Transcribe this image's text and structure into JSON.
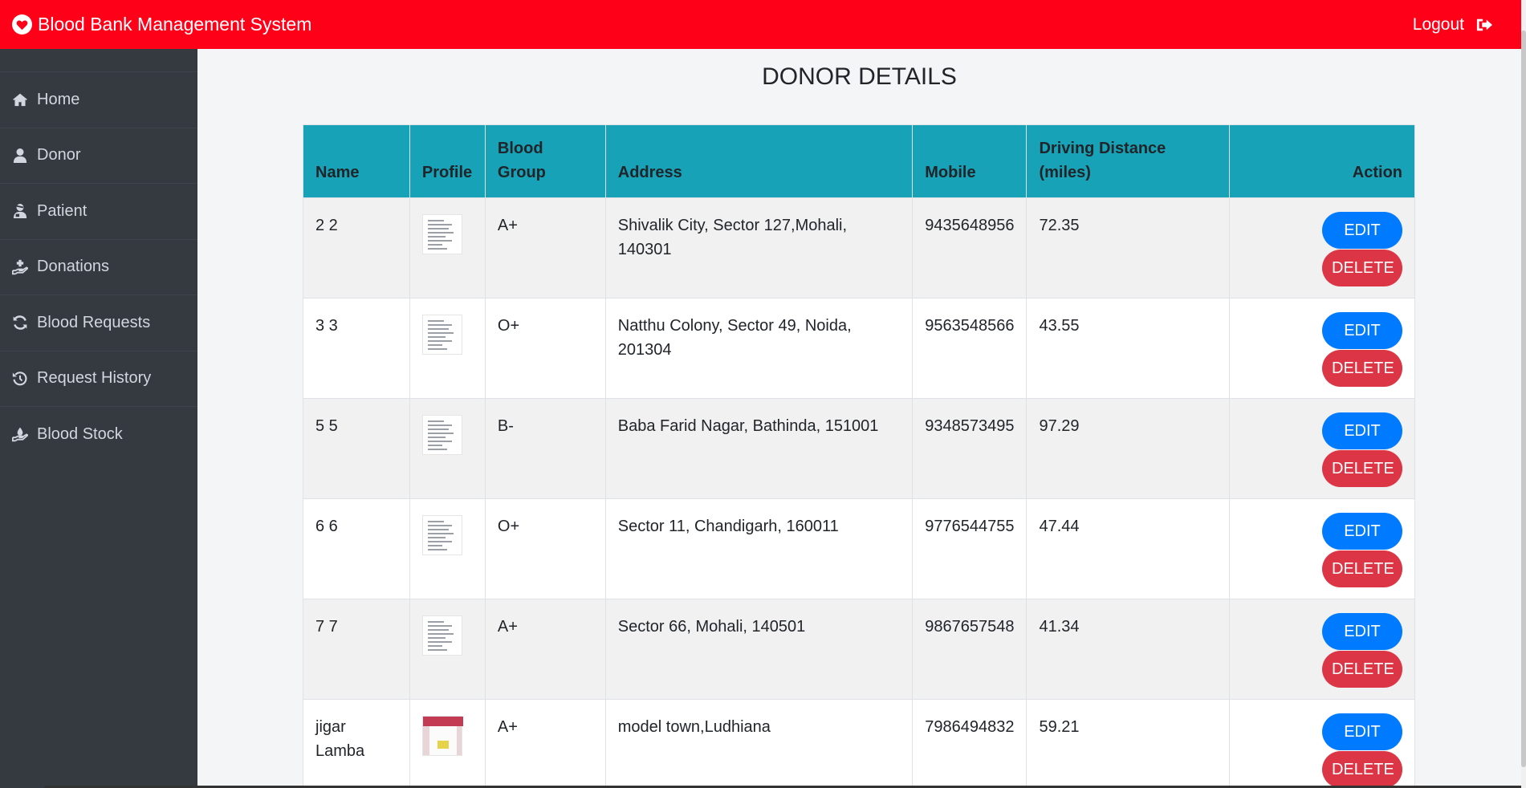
{
  "header": {
    "app_title": "Blood Bank Management System",
    "logout_label": "Logout",
    "brand_icon": "heart-icon",
    "logout_icon": "sign-out-icon",
    "brand_color": "#ff0019"
  },
  "sidebar": {
    "items": [
      {
        "label": "Home",
        "icon": "home-icon"
      },
      {
        "label": "Donor",
        "icon": "user-icon"
      },
      {
        "label": "Patient",
        "icon": "user-injured-icon"
      },
      {
        "label": "Donations",
        "icon": "hand-holding-plus-icon"
      },
      {
        "label": "Blood Requests",
        "icon": "sync-icon"
      },
      {
        "label": "Request History",
        "icon": "history-icon"
      },
      {
        "label": "Blood Stock",
        "icon": "hand-holding-icon"
      }
    ]
  },
  "main": {
    "page_title": "DONOR DETAILS",
    "columns": [
      "Name",
      "Profile",
      "Blood Group",
      "Address",
      "Mobile",
      "Driving Distance (miles)",
      "Action"
    ],
    "edit_label": "EDIT",
    "delete_label": "DELETE",
    "rows": [
      {
        "name": "2 2",
        "blood_group": "A+",
        "address": "Shivalik City, Sector 127,Mohali, 140301",
        "mobile": "9435648956",
        "distance": "72.35"
      },
      {
        "name": "3 3",
        "blood_group": "O+",
        "address": "Natthu Colony, Sector 49, Noida, 201304",
        "mobile": "9563548566",
        "distance": "43.55"
      },
      {
        "name": "5 5",
        "blood_group": "B-",
        "address": "Baba Farid Nagar, Bathinda, 151001",
        "mobile": "9348573495",
        "distance": "97.29"
      },
      {
        "name": "6 6",
        "blood_group": "O+",
        "address": "Sector 11, Chandigarh, 160011",
        "mobile": "9776544755",
        "distance": "47.44"
      },
      {
        "name": "7 7",
        "blood_group": "A+",
        "address": "Sector 66, Mohali, 140501",
        "mobile": "9867657548",
        "distance": "41.34"
      },
      {
        "name": "jigar Lamba",
        "blood_group": "A+",
        "address": "model town,Ludhiana",
        "mobile": "7986494832",
        "distance": "59.21"
      }
    ]
  }
}
